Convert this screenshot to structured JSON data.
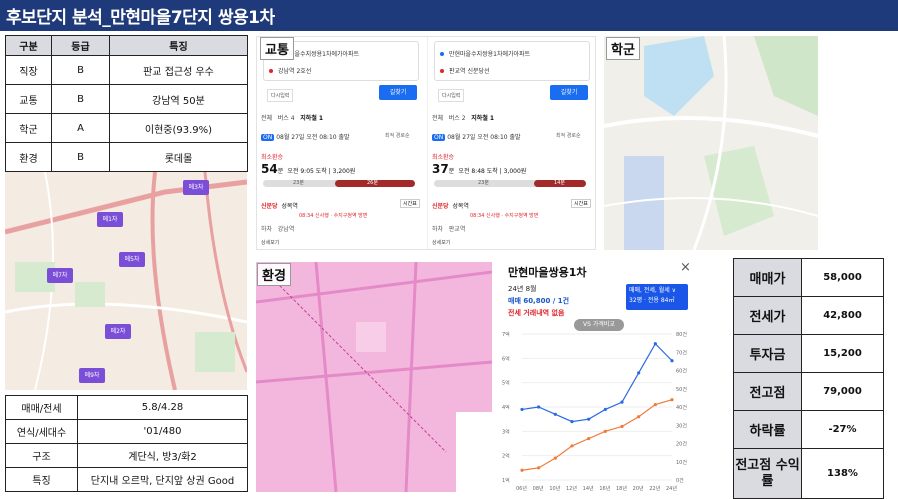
{
  "title": "후보단지 분석_만현마을7단지 쌍용1차",
  "summary_table": {
    "headers": [
      "구분",
      "등급",
      "특징"
    ],
    "rows": [
      [
        "직장",
        "B",
        "판교 접근성 우수"
      ],
      [
        "교통",
        "B",
        "강남역 50분"
      ],
      [
        "학군",
        "A",
        "이현중(93.9%)"
      ],
      [
        "환경",
        "B",
        "롯데몰"
      ]
    ]
  },
  "detail_table": {
    "rows": [
      [
        "매매/전세",
        "5.8/4.28"
      ],
      [
        "연식/세대수",
        "'01/480"
      ],
      [
        "구조",
        "계단식, 방3/화2"
      ],
      [
        "특징",
        "단지내 오르막, 단지앞 상권 Good"
      ]
    ]
  },
  "invest_table": {
    "rows": [
      [
        "매매가",
        "58,000"
      ],
      [
        "전세가",
        "42,800"
      ],
      [
        "투자금",
        "15,200"
      ],
      [
        "전고점",
        "79,000"
      ],
      [
        "하락률",
        "-27%"
      ],
      [
        "전고점 수익률",
        "138%"
      ]
    ]
  },
  "panel_tags": {
    "transit": "교통",
    "school": "학군",
    "env": "환경"
  },
  "map_markers": [
    "메3차",
    "메1차",
    "메7차",
    "메5차",
    "메2차",
    "메9차"
  ],
  "transit": {
    "columns": [
      {
        "origin": "만현마을수지쌍용1차에가아파트",
        "destination": "강남역 2호선",
        "reset": "다시입력",
        "go": "길찾기",
        "tabs": [
          "전체",
          "버스 4",
          "지하철 1"
        ],
        "on_badge": "ON",
        "depart": "08월 27일 오전 08:10 출발",
        "sort": "최적 경로순",
        "best": "최소환승",
        "duration": "54",
        "duration_unit": "분",
        "duration_detail": "오전 9:05 도착 | 3,200원",
        "seg_labels": [
          "23분",
          "26분"
        ],
        "board_station": "신분당",
        "board_stop": "성복역",
        "board_detail": "08:34 신사행 · 수지구청역 방면",
        "alight": "하차",
        "alight_stop": "강남역",
        "timetable": "시간표",
        "more": "상세보기"
      },
      {
        "origin": "만현마을수지쌍용1차에가아파트",
        "destination": "판교역 신분당선",
        "reset": "다시입력",
        "go": "길찾기",
        "tabs": [
          "전체",
          "버스 2",
          "지하철 1"
        ],
        "on_badge": "ON",
        "depart": "08월 27일 오전 08:10 출발",
        "sort": "최적 경로순",
        "best": "최소환승",
        "duration": "37",
        "duration_unit": "분",
        "duration_detail": "오전 8:48 도착 | 3,000원",
        "seg_labels": [
          "23분",
          "14분"
        ],
        "board_station": "신분당",
        "board_stop": "성복역",
        "board_detail": "08:34 신사행 · 수지구청역 방면",
        "alight": "하차",
        "alight_stop": "판교역",
        "timetable": "시간표",
        "more": "상세보기"
      }
    ]
  },
  "price_panel": {
    "title": "만현마을쌍용1차",
    "close": "×",
    "date": "24년 8월",
    "trade": "매매 60,800 / 1건",
    "rent": "전세 거래내역 없음",
    "filter_line1": "매매, 전세, 월세 ∨",
    "filter_line2": "32평 · 전용 84㎡",
    "vs_button": "VS 가격비교",
    "chart_data": {
      "type": "line",
      "title": "",
      "xlabel": "",
      "ylabel": "",
      "x": [
        "06년",
        "08년",
        "10년",
        "12년",
        "14년",
        "16년",
        "18년",
        "20년",
        "22년",
        "24년"
      ],
      "ylim": [
        1,
        7
      ],
      "y_ticks": [
        "1억",
        "2억",
        "3억",
        "4억",
        "5억",
        "6억",
        "7억"
      ],
      "y2_ticks": [
        "0건",
        "10건",
        "20건",
        "30건",
        "40건",
        "50건",
        "60건",
        "70건",
        "80건"
      ],
      "series": [
        {
          "name": "매매",
          "color": "#2a6ae0",
          "values": [
            3.9,
            4.0,
            3.7,
            3.4,
            3.5,
            3.9,
            4.2,
            5.4,
            6.6,
            5.9
          ]
        },
        {
          "name": "전세",
          "color": "#f07a3c",
          "values": [
            1.4,
            1.5,
            1.9,
            2.4,
            2.7,
            3.0,
            3.2,
            3.6,
            4.1,
            4.3
          ]
        }
      ]
    }
  }
}
